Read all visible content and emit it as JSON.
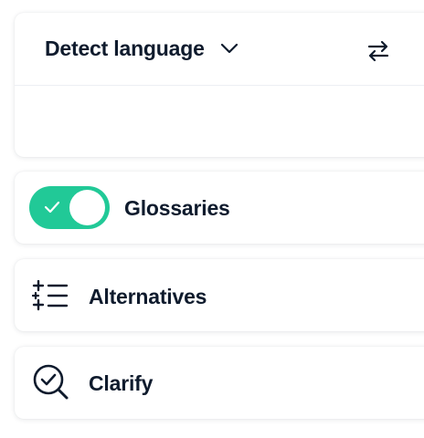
{
  "language_selector": {
    "label": "Detect language",
    "dropdown_icon": "chevron-down-icon",
    "swap_icon": "swap-arrows-icon"
  },
  "glossaries": {
    "label": "Glossaries",
    "toggle_on": true,
    "toggle_icon": "check-icon"
  },
  "alternatives": {
    "label": "Alternatives",
    "icon": "sparkle-list-icon"
  },
  "clarify": {
    "label": "Clarify",
    "icon": "magnifier-check-icon"
  },
  "colors": {
    "text": "#0f1b2d",
    "toggle_on": "#21c997",
    "card_bg": "#ffffff"
  }
}
